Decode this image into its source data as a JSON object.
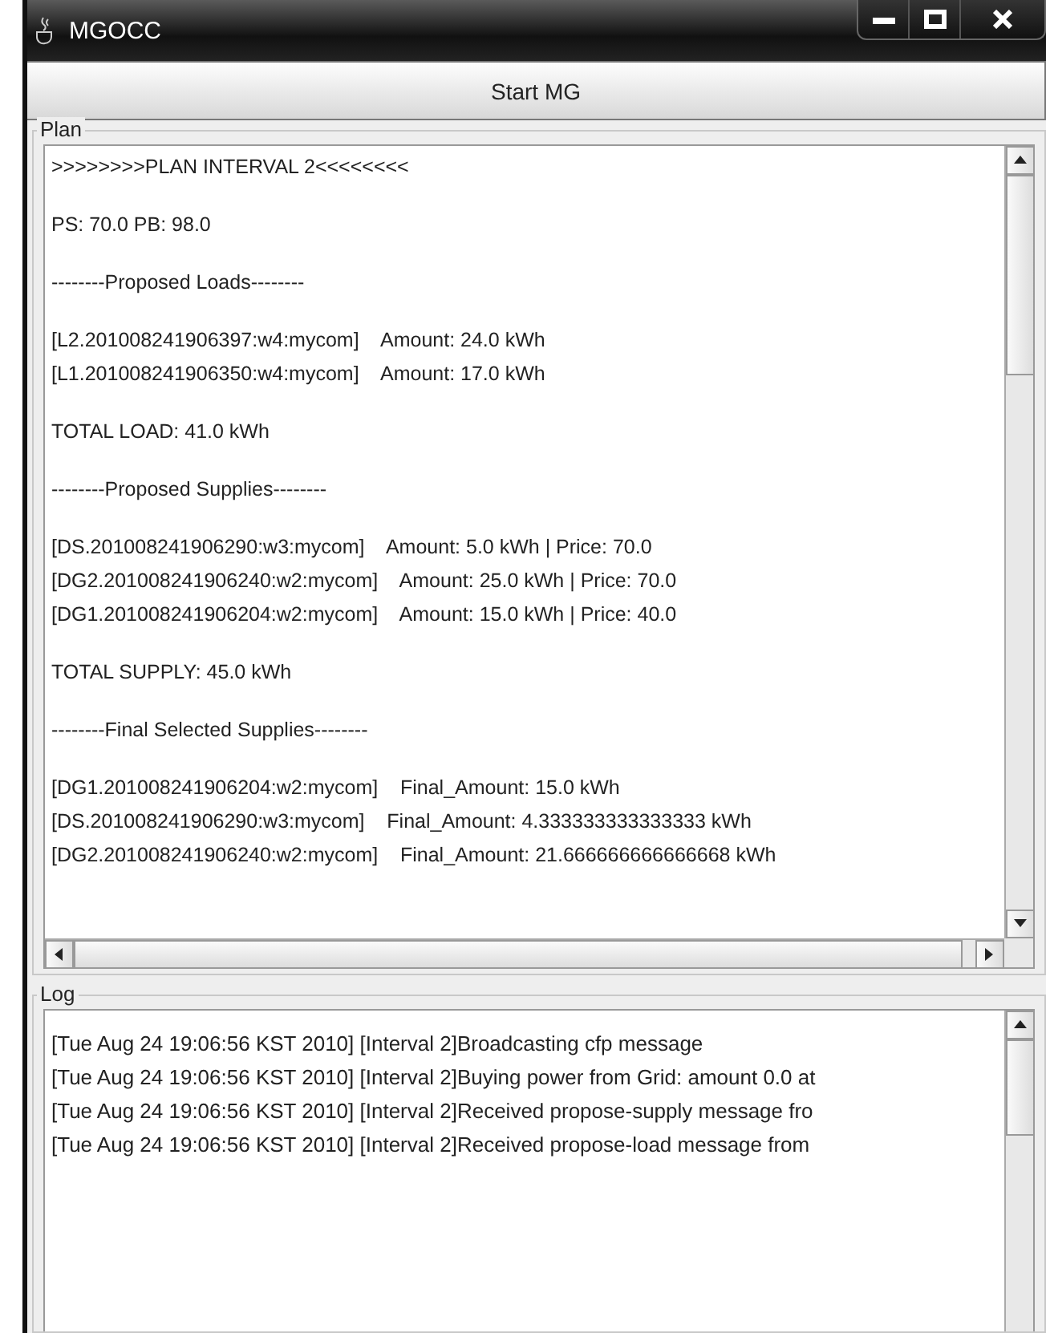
{
  "window": {
    "title": "MGOCC"
  },
  "start_button": {
    "label": "Start MG"
  },
  "plan": {
    "legend": "Plan",
    "paragraphs": [
      [
        ">>>>>>>>PLAN INTERVAL 2<<<<<<<<"
      ],
      [
        "PS: 70.0 PB: 98.0"
      ],
      [
        "--------Proposed Loads--------"
      ],
      [
        "[L2.201008241906397:w4:mycom]    Amount: 24.0 kWh",
        "[L1.201008241906350:w4:mycom]    Amount: 17.0 kWh"
      ],
      [
        "TOTAL LOAD: 41.0 kWh"
      ],
      [
        "--------Proposed Supplies--------"
      ],
      [
        "[DS.201008241906290:w3:mycom]    Amount: 5.0 kWh | Price: 70.0",
        "[DG2.201008241906240:w2:mycom]    Amount: 25.0 kWh | Price: 70.0",
        "[DG1.201008241906204:w2:mycom]    Amount: 15.0 kWh | Price: 40.0"
      ],
      [
        "TOTAL SUPPLY: 45.0 kWh"
      ],
      [
        "--------Final Selected Supplies--------"
      ],
      [
        "[DG1.201008241906204:w2:mycom]    Final_Amount: 15.0 kWh",
        "[DS.201008241906290:w3:mycom]    Final_Amount: 4.333333333333333 kWh",
        "[DG2.201008241906240:w2:mycom]    Final_Amount: 21.666666666666668 kWh"
      ]
    ]
  },
  "log": {
    "legend": "Log",
    "lines": [
      "[Tue Aug 24 19:06:56 KST 2010] [Interval 2]Broadcasting cfp message",
      "[Tue Aug 24 19:06:56 KST 2010] [Interval 2]Buying power from Grid: amount 0.0 at",
      "[Tue Aug 24 19:06:56 KST 2010] [Interval 2]Received propose-supply message fro",
      "[Tue Aug 24 19:06:56 KST 2010] [Interval 2]Received propose-load message from"
    ]
  }
}
